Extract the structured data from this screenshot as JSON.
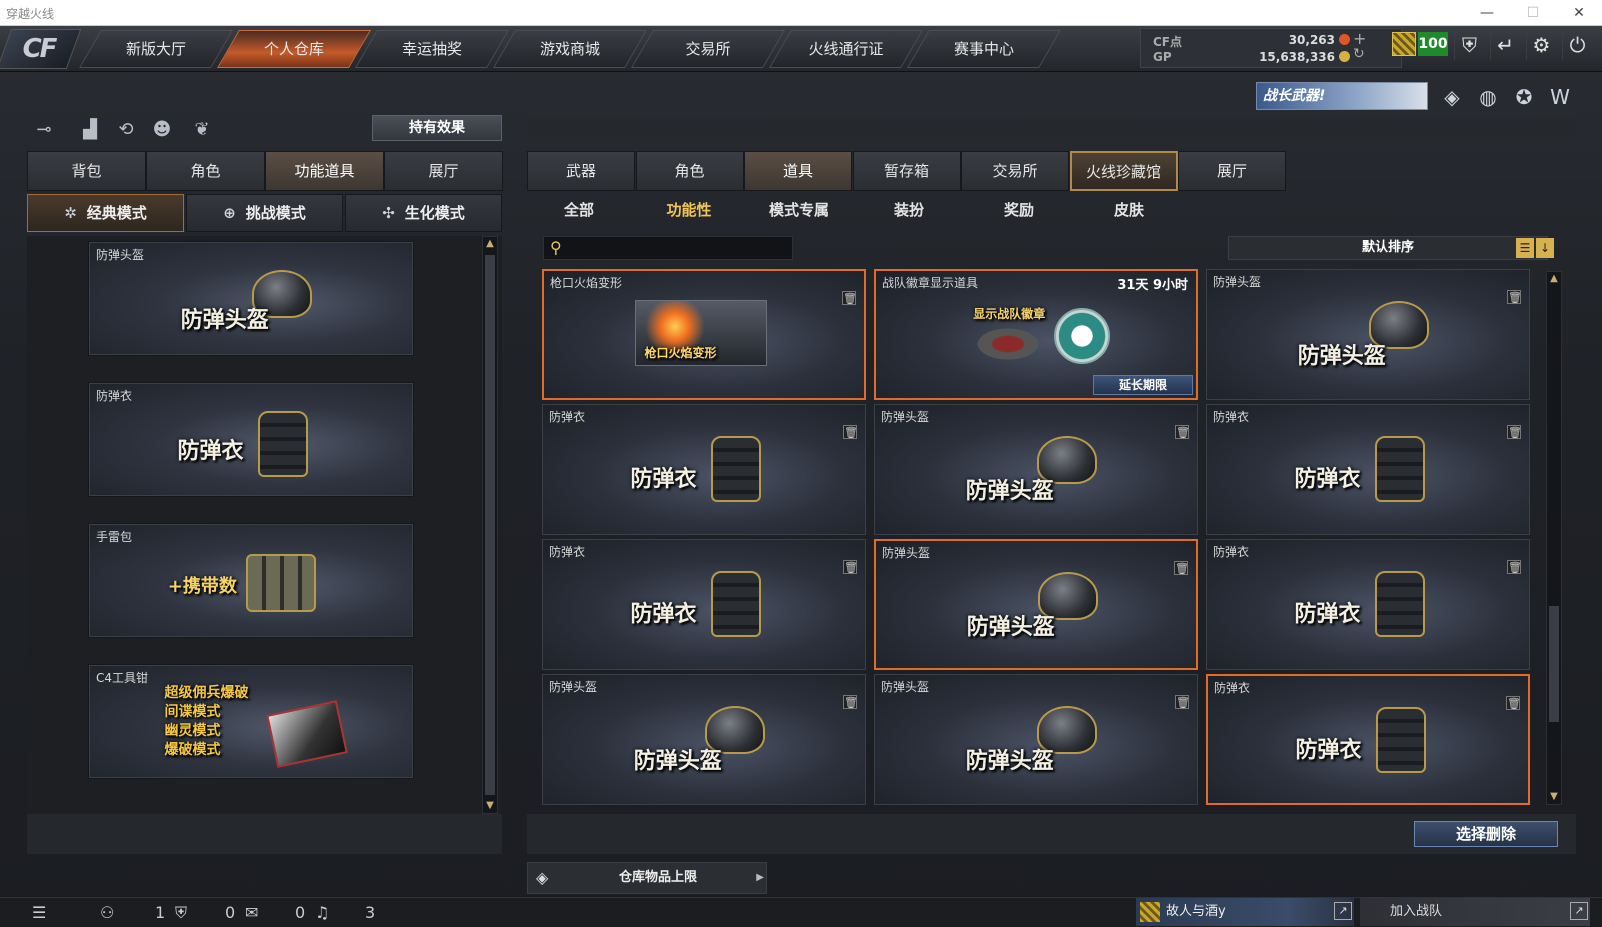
{
  "window": {
    "title": "穿越火线"
  },
  "logo": {
    "text": "CF"
  },
  "nav": {
    "tabs": [
      {
        "label": "新版大厅"
      },
      {
        "label": "个人仓库",
        "active": true
      },
      {
        "label": "幸运抽奖"
      },
      {
        "label": "游戏商城"
      },
      {
        "label": "交易所"
      },
      {
        "label": "火线通行证"
      },
      {
        "label": "赛事中心"
      }
    ]
  },
  "currency": {
    "cf_label": "CF点",
    "cf_value": "30,263",
    "gp_label": "GP",
    "gp_value": "15,638,336",
    "level": "100"
  },
  "banner": {
    "text": "战长武器!"
  },
  "left": {
    "effect_button": "持有效果",
    "tabs": [
      {
        "label": "背包"
      },
      {
        "label": "角色"
      },
      {
        "label": "功能道具",
        "active": true
      },
      {
        "label": "展厅"
      }
    ],
    "modes": [
      {
        "label": "经典模式",
        "icon": "✲",
        "active": true
      },
      {
        "label": "挑战模式",
        "icon": "⊕"
      },
      {
        "label": "生化模式",
        "icon": "✣"
      }
    ],
    "items": [
      {
        "name": "防弹头盔",
        "label": "防弹头盔",
        "kind": "helmet"
      },
      {
        "name": "防弹衣",
        "label": "防弹衣",
        "kind": "vest"
      },
      {
        "name": "手雷包",
        "label": "+携带数",
        "kind": "grenade"
      },
      {
        "name": "C4工具钳",
        "lines": [
          "超级佣兵爆破",
          "间谍模式",
          "幽灵模式",
          "爆破模式"
        ],
        "kind": "c4"
      }
    ]
  },
  "right": {
    "tabs": [
      {
        "label": "武器"
      },
      {
        "label": "角色"
      },
      {
        "label": "道具",
        "active": true
      },
      {
        "label": "暂存箱"
      },
      {
        "label": "交易所"
      },
      {
        "label": "火线珍藏馆",
        "highlight": true
      },
      {
        "label": "展厅"
      }
    ],
    "subtabs": [
      {
        "label": "全部"
      },
      {
        "label": "功能性",
        "active": true
      },
      {
        "label": "模式专属"
      },
      {
        "label": "装扮"
      },
      {
        "label": "奖励"
      },
      {
        "label": "皮肤"
      }
    ],
    "search": {
      "placeholder": ""
    },
    "sort": {
      "label": "默认排序"
    },
    "grid": [
      {
        "name": "枪口火焰变形",
        "label": "枪口火焰变形",
        "kind": "flame",
        "selected": true
      },
      {
        "name": "战队徽章显示道具",
        "label": "显示战队徽章",
        "kind": "badge",
        "time": "31天 9小时",
        "extend": "延长期限",
        "selected": true
      },
      {
        "name": "防弹头盔",
        "label": "防弹头盔",
        "kind": "helmet"
      },
      {
        "name": "防弹衣",
        "label": "防弹衣",
        "kind": "vest"
      },
      {
        "name": "防弹头盔",
        "label": "防弹头盔",
        "kind": "helmet"
      },
      {
        "name": "防弹衣",
        "label": "防弹衣",
        "kind": "vest"
      },
      {
        "name": "防弹衣",
        "label": "防弹衣",
        "kind": "vest"
      },
      {
        "name": "防弹头盔",
        "label": "防弹头盔",
        "kind": "helmet",
        "selected": true
      },
      {
        "name": "防弹衣",
        "label": "防弹衣",
        "kind": "vest"
      },
      {
        "name": "防弹头盔",
        "label": "防弹头盔",
        "kind": "helmet"
      },
      {
        "name": "防弹头盔",
        "label": "防弹头盔",
        "kind": "helmet"
      },
      {
        "name": "防弹衣",
        "label": "防弹衣",
        "kind": "vest",
        "selected": true
      }
    ],
    "delete_button": "选择删除",
    "capacity_label": "仓库物品上限"
  },
  "status": {
    "count1": "1",
    "count2": "0",
    "count3": "0",
    "count4": "3",
    "friend": "故人与酒y",
    "clan": "加入战队"
  }
}
